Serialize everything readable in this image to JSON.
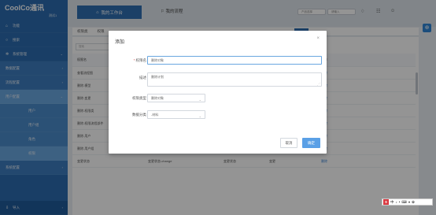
{
  "sidebar": {
    "logo": "CoolCo通讯",
    "logo_sub": "测试1",
    "items": [
      {
        "label": "功能",
        "icon": "home-icon"
      },
      {
        "label": "搜索",
        "icon": "search-icon"
      },
      {
        "label": "系统管理",
        "icon": "gear-icon"
      },
      {
        "label": "数据配置"
      },
      {
        "label": "流程配置"
      },
      {
        "label": "用户配置"
      },
      {
        "label": "用户"
      },
      {
        "label": "用户组"
      },
      {
        "label": "角色"
      },
      {
        "label": "权限"
      },
      {
        "label": "系统配置"
      },
      {
        "label": "导入"
      }
    ]
  },
  "header": {
    "workbench_label": "我的工作台",
    "my_process_label": "我的流程",
    "select1": "产品选择",
    "select2": "请输入"
  },
  "tabs": [
    "权限类",
    "权限",
    "",
    "",
    "",
    "",
    ""
  ],
  "panel": {
    "search_placeholder": "搜索",
    "columns": [
      "权限名",
      "编码",
      "类型",
      "分组",
      "操作"
    ],
    "rows": [
      [
        "查看流程图",
        "",
        "",
        "",
        "删除"
      ],
      [
        "删除-模型",
        "",
        "",
        "",
        "删除"
      ],
      [
        "删除-变更",
        "",
        "",
        "",
        "删除"
      ],
      [
        "删除-权限类",
        "",
        "",
        "",
        "删除"
      ],
      [
        "删除-权限流程部件",
        "",
        "",
        "",
        "删除"
      ],
      [
        "删除-用户",
        "删除-用户",
        "数据",
        "用户",
        "删除"
      ],
      [
        "删除-用户组",
        "删除-用户组",
        "数据",
        "用户组",
        "删除"
      ],
      [
        "变更状态",
        "变更状态-change",
        "变更状态",
        "变更",
        "删除"
      ]
    ]
  },
  "dialog": {
    "title": "添加",
    "close": "×",
    "fields": {
      "name_label": "权限名",
      "name_value": "删除对象",
      "desc_label": "描述",
      "desc_value": "删除计划",
      "type_label": "权限类型",
      "type_value": "删除对象",
      "category_label": "数据分类",
      "category_value": "-材料"
    },
    "cancel_label": "取消",
    "ok_label": "确定"
  },
  "ime": {
    "logo": "S",
    "items": [
      "中",
      "♪",
      "•",
      "⌨",
      "♦",
      "✿"
    ]
  },
  "colors": {
    "sidebar": "#2b6cb0",
    "primary": "#2f6fb2",
    "ok_button": "#5aa0e6"
  }
}
